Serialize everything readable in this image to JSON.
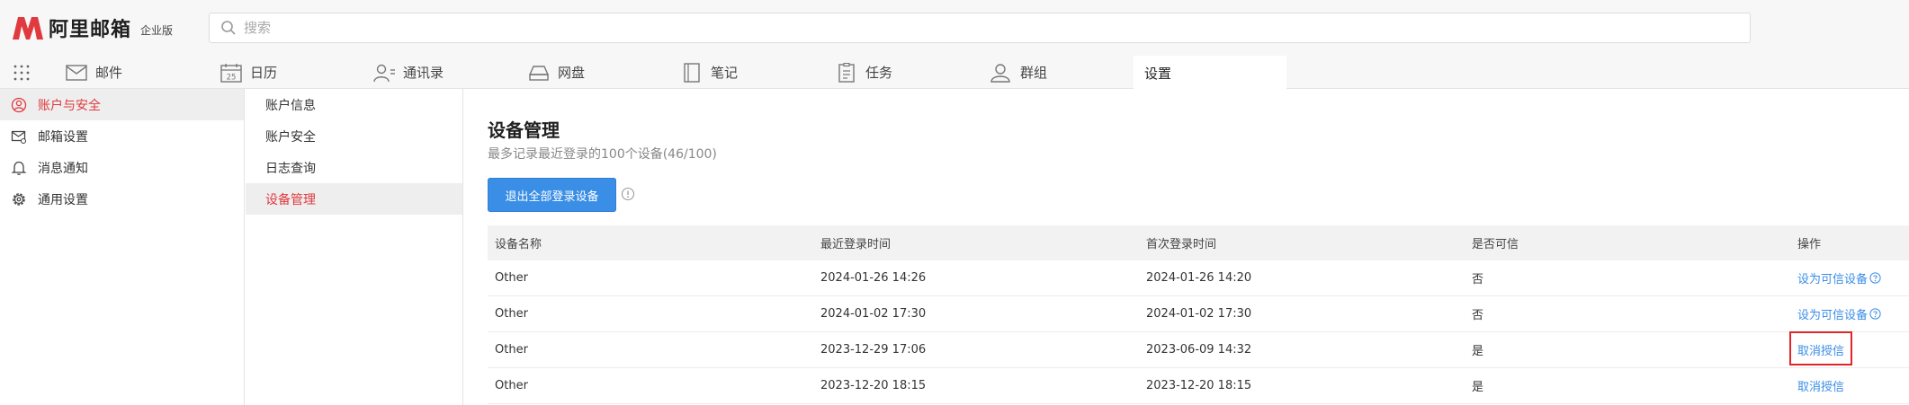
{
  "header": {
    "logo_text": "阿里邮箱",
    "edition": "企业版",
    "search_placeholder": "搜索"
  },
  "nav": {
    "tabs": [
      {
        "label": "邮件"
      },
      {
        "label": "日历",
        "icon_text": "25"
      },
      {
        "label": "通讯录"
      },
      {
        "label": "网盘"
      },
      {
        "label": "笔记"
      },
      {
        "label": "任务"
      },
      {
        "label": "群组"
      },
      {
        "label": "设置"
      }
    ]
  },
  "sidebar": {
    "items": [
      {
        "label": "账户与安全"
      },
      {
        "label": "邮箱设置"
      },
      {
        "label": "消息通知"
      },
      {
        "label": "通用设置"
      }
    ]
  },
  "submenu": {
    "items": [
      {
        "label": "账户信息"
      },
      {
        "label": "账户安全"
      },
      {
        "label": "日志查询"
      },
      {
        "label": "设备管理"
      }
    ]
  },
  "main": {
    "title": "设备管理",
    "subtitle": "最多记录最近登录的100个设备(46/100)",
    "logout_all_label": "退出全部登录设备",
    "table": {
      "headers": [
        "设备名称",
        "最近登录时间",
        "首次登录时间",
        "是否可信",
        "操作"
      ],
      "rows": [
        {
          "device": "Other",
          "last_login": "2024-01-26 14:26",
          "first_login": "2024-01-26 14:20",
          "trusted": "否",
          "action": "设为可信设备"
        },
        {
          "device": "Other",
          "last_login": "2024-01-02 17:30",
          "first_login": "2024-01-02 17:30",
          "trusted": "否",
          "action": "设为可信设备"
        },
        {
          "device": "Other",
          "last_login": "2023-12-29 17:06",
          "first_login": "2023-06-09 14:32",
          "trusted": "是",
          "action": "取消授信"
        },
        {
          "device": "Other",
          "last_login": "2023-12-20 18:15",
          "first_login": "2023-12-20 18:15",
          "trusted": "是",
          "action": "取消授信"
        }
      ]
    }
  },
  "colors": {
    "brand_red": "#e0393e",
    "link_blue": "#3a8ee6",
    "highlight_red": "#e0262a"
  }
}
